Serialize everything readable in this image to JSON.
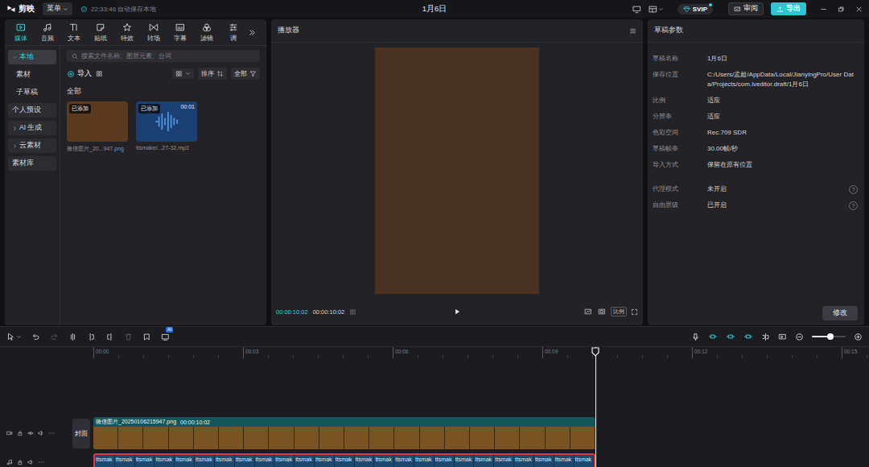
{
  "app": {
    "logo": "剪映",
    "menu": "菜单",
    "autosave": "22:33:46 自动保存本地",
    "title": "1月6日",
    "svip": "SVIP",
    "review": "审阅",
    "export": "导出"
  },
  "media_tabs": [
    {
      "label": "媒体",
      "selected": true
    },
    {
      "label": "音频",
      "selected": false
    },
    {
      "label": "文本",
      "selected": false
    },
    {
      "label": "贴纸",
      "selected": false
    },
    {
      "label": "特效",
      "selected": false
    },
    {
      "label": "转场",
      "selected": false
    },
    {
      "label": "字幕",
      "selected": false
    },
    {
      "label": "滤镜",
      "selected": false
    },
    {
      "label": "调",
      "selected": false
    }
  ],
  "sidebar": [
    {
      "label": "本地",
      "selected": true,
      "nested": false,
      "expandable": true,
      "expanded": true
    },
    {
      "label": "素材",
      "selected": false,
      "nested": true,
      "expandable": false,
      "expanded": false
    },
    {
      "label": "子草稿",
      "selected": false,
      "nested": true,
      "expandable": false,
      "expanded": false
    },
    {
      "label": "个人预设",
      "selected": false,
      "nested": false,
      "expandable": false,
      "expanded": false
    },
    {
      "label": "AI 生成",
      "selected": false,
      "nested": false,
      "expandable": true,
      "expanded": false
    },
    {
      "label": "云素材",
      "selected": false,
      "nested": false,
      "expandable": true,
      "expanded": false
    },
    {
      "label": "素材库",
      "selected": false,
      "nested": false,
      "expandable": false,
      "expanded": false
    }
  ],
  "search": {
    "placeholder": "搜索文件名称、图层元素、台词"
  },
  "library_toolbar": {
    "import": "导入",
    "sort": "排序",
    "filter": "全部"
  },
  "section": "全部",
  "media": [
    {
      "kind": "image",
      "name": "微信图片_20...947.png",
      "badge": "已添加",
      "duration": ""
    },
    {
      "kind": "audio",
      "name": "ttsmaker...27-32.mp3",
      "badge": "已添加",
      "duration": "00:01"
    }
  ],
  "player": {
    "title": "播放器",
    "current": "00:00:10:02",
    "total": "00:00:10:02",
    "ratio": "比例"
  },
  "draft": {
    "title": "草稿参数",
    "help": "?",
    "sections": [
      [
        {
          "label": "草稿名称",
          "value": "1月6日",
          "help": false
        },
        {
          "label": "保存位置",
          "value": "C:/Users/孟超/AppData/Local/JianyingPro/User Data/Projects/com.lveditor.draft/1月6日",
          "help": false
        },
        {
          "label": "比例",
          "value": "适应",
          "help": false
        },
        {
          "label": "分辨率",
          "value": "适应",
          "help": false
        },
        {
          "label": "色彩空间",
          "value": "Rec.709 SDR",
          "help": false
        },
        {
          "label": "草稿帧率",
          "value": "30.00帧/秒",
          "help": false
        },
        {
          "label": "导入方式",
          "value": "保留在原有位置",
          "help": false
        }
      ],
      [
        {
          "label": "代理模式",
          "value": "未开启",
          "help": true
        },
        {
          "label": "自由层级",
          "value": "已开启",
          "help": true
        }
      ]
    ],
    "button": "修改"
  },
  "timeline": {
    "tools": [
      {
        "disabled": false,
        "badge": ""
      },
      {
        "disabled": false,
        "badge": ""
      },
      {
        "disabled": true,
        "badge": ""
      },
      {
        "disabled": false,
        "badge": ""
      },
      {
        "disabled": false,
        "badge": ""
      },
      {
        "disabled": false,
        "badge": ""
      },
      {
        "disabled": true,
        "badge": ""
      },
      {
        "disabled": false,
        "badge": ""
      },
      {
        "disabled": false,
        "badge": "AI"
      }
    ],
    "toggles": [
      {
        "on": true
      },
      {
        "on": true
      },
      {
        "on": true
      }
    ],
    "zoom": {
      "level": 0.55
    },
    "ticks": [
      "00:00",
      "00:03",
      "00:06",
      "00:09",
      "00:12",
      "00:15"
    ],
    "cover": "封面",
    "video_clip": {
      "name": "微信图片_20250106215947.png",
      "duration": "00:00:10:02"
    },
    "audio_track": {
      "selected": true,
      "clips": [
        "ttsmak",
        "ttsmak",
        "ttsmak",
        "ttsmak",
        "ttsmak",
        "ttsmak",
        "ttsmak",
        "ttsmak",
        "ttsmak",
        "ttsmak",
        "ttsmak",
        "ttsmak",
        "ttsmak",
        "ttsmak",
        "ttsmak",
        "ttsmak",
        "ttsmak",
        "ttsmak",
        "ttsmak",
        "ttsmak",
        "ttsmak",
        "ttsmak",
        "ttsmak",
        "ttsmak",
        "ttsmak"
      ]
    }
  }
}
